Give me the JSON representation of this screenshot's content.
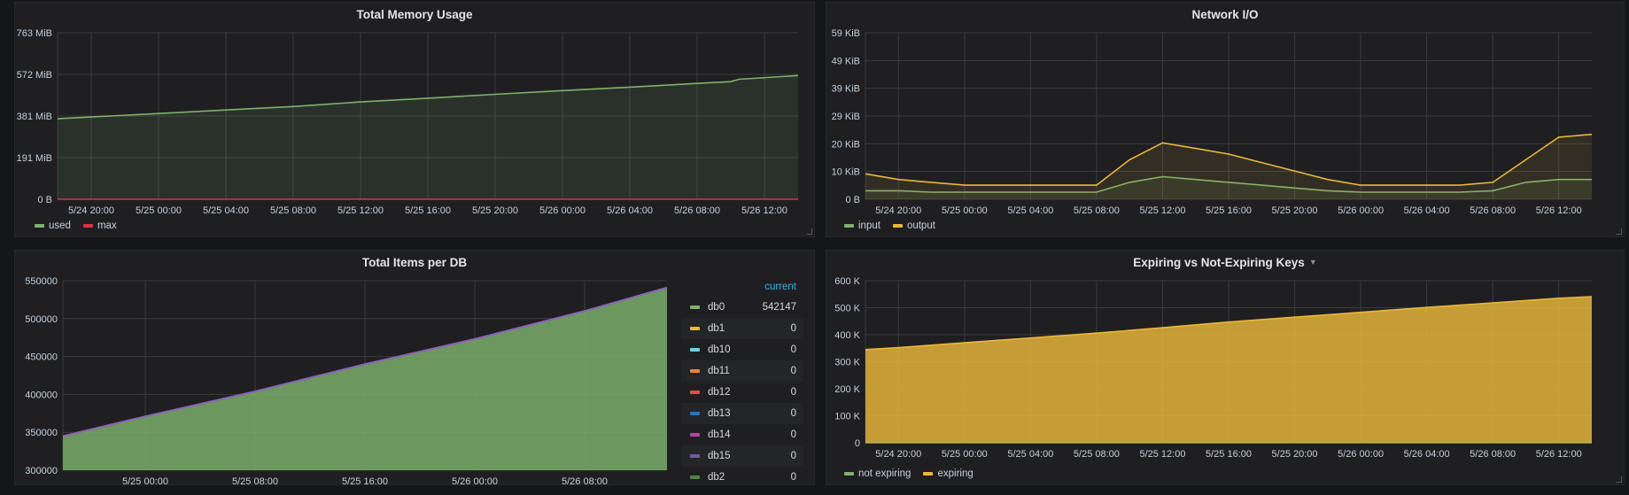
{
  "panels": {
    "memory": {
      "title": "Total Memory Usage",
      "legend": [
        {
          "label": "used",
          "color": "#7eb26d"
        },
        {
          "label": "max",
          "color": "#e02f44"
        }
      ]
    },
    "network": {
      "title": "Network I/O",
      "legend": [
        {
          "label": "input",
          "color": "#7eb26d"
        },
        {
          "label": "output",
          "color": "#eab839"
        }
      ]
    },
    "items": {
      "title": "Total Items per DB",
      "table_header": "current",
      "rows": [
        {
          "name": "db0",
          "value": "542147",
          "color": "#7eb26d"
        },
        {
          "name": "db1",
          "value": "0",
          "color": "#eab839"
        },
        {
          "name": "db10",
          "value": "0",
          "color": "#6ed0e0"
        },
        {
          "name": "db11",
          "value": "0",
          "color": "#ef843c"
        },
        {
          "name": "db12",
          "value": "0",
          "color": "#e24d42"
        },
        {
          "name": "db13",
          "value": "0",
          "color": "#1f78c1"
        },
        {
          "name": "db14",
          "value": "0",
          "color": "#ba43a9"
        },
        {
          "name": "db15",
          "value": "0",
          "color": "#705da0"
        },
        {
          "name": "db2",
          "value": "0",
          "color": "#508642"
        }
      ]
    },
    "keys": {
      "title": "Expiring vs Not-Expiring Keys",
      "legend": [
        {
          "label": "not expiring",
          "color": "#7eb26d"
        },
        {
          "label": "expiring",
          "color": "#eab839"
        }
      ]
    }
  },
  "chart_data": [
    {
      "id": "memory",
      "type": "area",
      "title": "Total Memory Usage",
      "x": [
        "5/24 18:00",
        "5/24 20:00",
        "5/25 00:00",
        "5/25 04:00",
        "5/25 08:00",
        "5/25 12:00",
        "5/25 16:00",
        "5/25 20:00",
        "5/26 00:00",
        "5/26 04:00",
        "5/26 08:00",
        "5/26 10:00",
        "5/26 10:30",
        "5/26 14:00"
      ],
      "series": [
        {
          "name": "used",
          "color": "#7eb26d",
          "values": [
            369,
            377,
            393,
            409,
            425,
            446,
            463,
            481,
            498,
            514,
            531,
            539,
            550,
            567
          ]
        },
        {
          "name": "max",
          "color": "#e02f44",
          "values": [
            0,
            0,
            0,
            0,
            0,
            0,
            0,
            0,
            0,
            0,
            0,
            0,
            0,
            0
          ]
        }
      ],
      "x_ticks": [
        "5/24 20:00",
        "5/25 00:00",
        "5/25 04:00",
        "5/25 08:00",
        "5/25 12:00",
        "5/25 16:00",
        "5/25 20:00",
        "5/26 00:00",
        "5/26 04:00",
        "5/26 08:00",
        "5/26 12:00"
      ],
      "y_ticks": [
        "0 B",
        "191 MiB",
        "381 MiB",
        "572 MiB",
        "763 MiB"
      ],
      "ylim": [
        0,
        763
      ],
      "grid": true
    },
    {
      "id": "network",
      "type": "line",
      "title": "Network I/O",
      "x": [
        "5/24 18:00",
        "5/24 20:00",
        "5/24 22:00",
        "5/25 00:00",
        "5/25 02:00",
        "5/25 04:00",
        "5/25 06:00",
        "5/25 08:00",
        "5/25 10:00",
        "5/25 12:00",
        "5/25 14:00",
        "5/25 16:00",
        "5/25 18:00",
        "5/25 20:00",
        "5/25 22:00",
        "5/26 00:00",
        "5/26 02:00",
        "5/26 04:00",
        "5/26 06:00",
        "5/26 08:00",
        "5/26 10:00",
        "5/26 12:00",
        "5/26 14:00"
      ],
      "series": [
        {
          "name": "input",
          "color": "#7eb26d",
          "values": [
            3,
            3,
            2.5,
            2.5,
            2.5,
            2.5,
            2.5,
            2.5,
            6,
            8,
            7,
            6,
            5,
            4,
            3,
            2.5,
            2.5,
            2.5,
            2.5,
            3,
            6,
            7,
            7
          ]
        },
        {
          "name": "output",
          "color": "#eab839",
          "values": [
            9,
            7,
            6,
            5,
            5,
            5,
            5,
            5,
            14,
            20,
            18,
            16,
            13,
            10,
            7,
            5,
            5,
            5,
            5,
            6,
            14,
            22,
            23
          ]
        }
      ],
      "x_ticks": [
        "5/24 20:00",
        "5/25 00:00",
        "5/25 04:00",
        "5/25 08:00",
        "5/25 12:00",
        "5/25 16:00",
        "5/25 20:00",
        "5/26 00:00",
        "5/26 04:00",
        "5/26 08:00",
        "5/26 12:00"
      ],
      "y_ticks": [
        "0 B",
        "10 KiB",
        "20 KiB",
        "29 KiB",
        "39 KiB",
        "49 KiB",
        "59 KiB"
      ],
      "ylim": [
        0,
        59
      ],
      "grid": true
    },
    {
      "id": "items",
      "type": "area",
      "title": "Total Items per DB",
      "x": [
        "5/24 18:00",
        "5/25 00:00",
        "5/25 08:00",
        "5/25 16:00",
        "5/26 00:00",
        "5/26 08:00",
        "5/26 14:00"
      ],
      "series": [
        {
          "name": "db0",
          "color": "#7eb26d",
          "values": [
            345000,
            371000,
            404000,
            440000,
            473000,
            510000,
            541000
          ]
        }
      ],
      "x_ticks": [
        "5/25 00:00",
        "5/25 08:00",
        "5/25 16:00",
        "5/26 00:00",
        "5/26 08:00"
      ],
      "y_ticks": [
        "300000",
        "350000",
        "400000",
        "450000",
        "500000",
        "550000"
      ],
      "ylim": [
        300000,
        550000
      ],
      "grid": true
    },
    {
      "id": "keys",
      "type": "area",
      "title": "Expiring vs Not-Expiring Keys",
      "x": [
        "5/24 18:00",
        "5/24 20:00",
        "5/25 00:00",
        "5/25 04:00",
        "5/25 08:00",
        "5/25 12:00",
        "5/25 16:00",
        "5/25 20:00",
        "5/26 00:00",
        "5/26 04:00",
        "5/26 08:00",
        "5/26 12:00",
        "5/26 14:00"
      ],
      "series": [
        {
          "name": "not expiring",
          "color": "#7eb26d",
          "values": [
            0,
            0,
            0,
            0,
            0,
            0,
            0,
            0,
            0,
            0,
            0,
            0,
            0
          ]
        },
        {
          "name": "expiring",
          "color": "#eab839",
          "values": [
            345,
            352,
            370,
            388,
            406,
            426,
            447,
            465,
            483,
            501,
            518,
            535,
            541
          ]
        }
      ],
      "x_ticks": [
        "5/24 20:00",
        "5/25 00:00",
        "5/25 04:00",
        "5/25 08:00",
        "5/25 12:00",
        "5/25 16:00",
        "5/25 20:00",
        "5/26 00:00",
        "5/26 04:00",
        "5/26 08:00",
        "5/26 12:00"
      ],
      "y_ticks": [
        "0",
        "100 K",
        "200 K",
        "300 K",
        "400 K",
        "500 K",
        "600 K"
      ],
      "ylim": [
        0,
        600
      ],
      "grid": true
    }
  ]
}
